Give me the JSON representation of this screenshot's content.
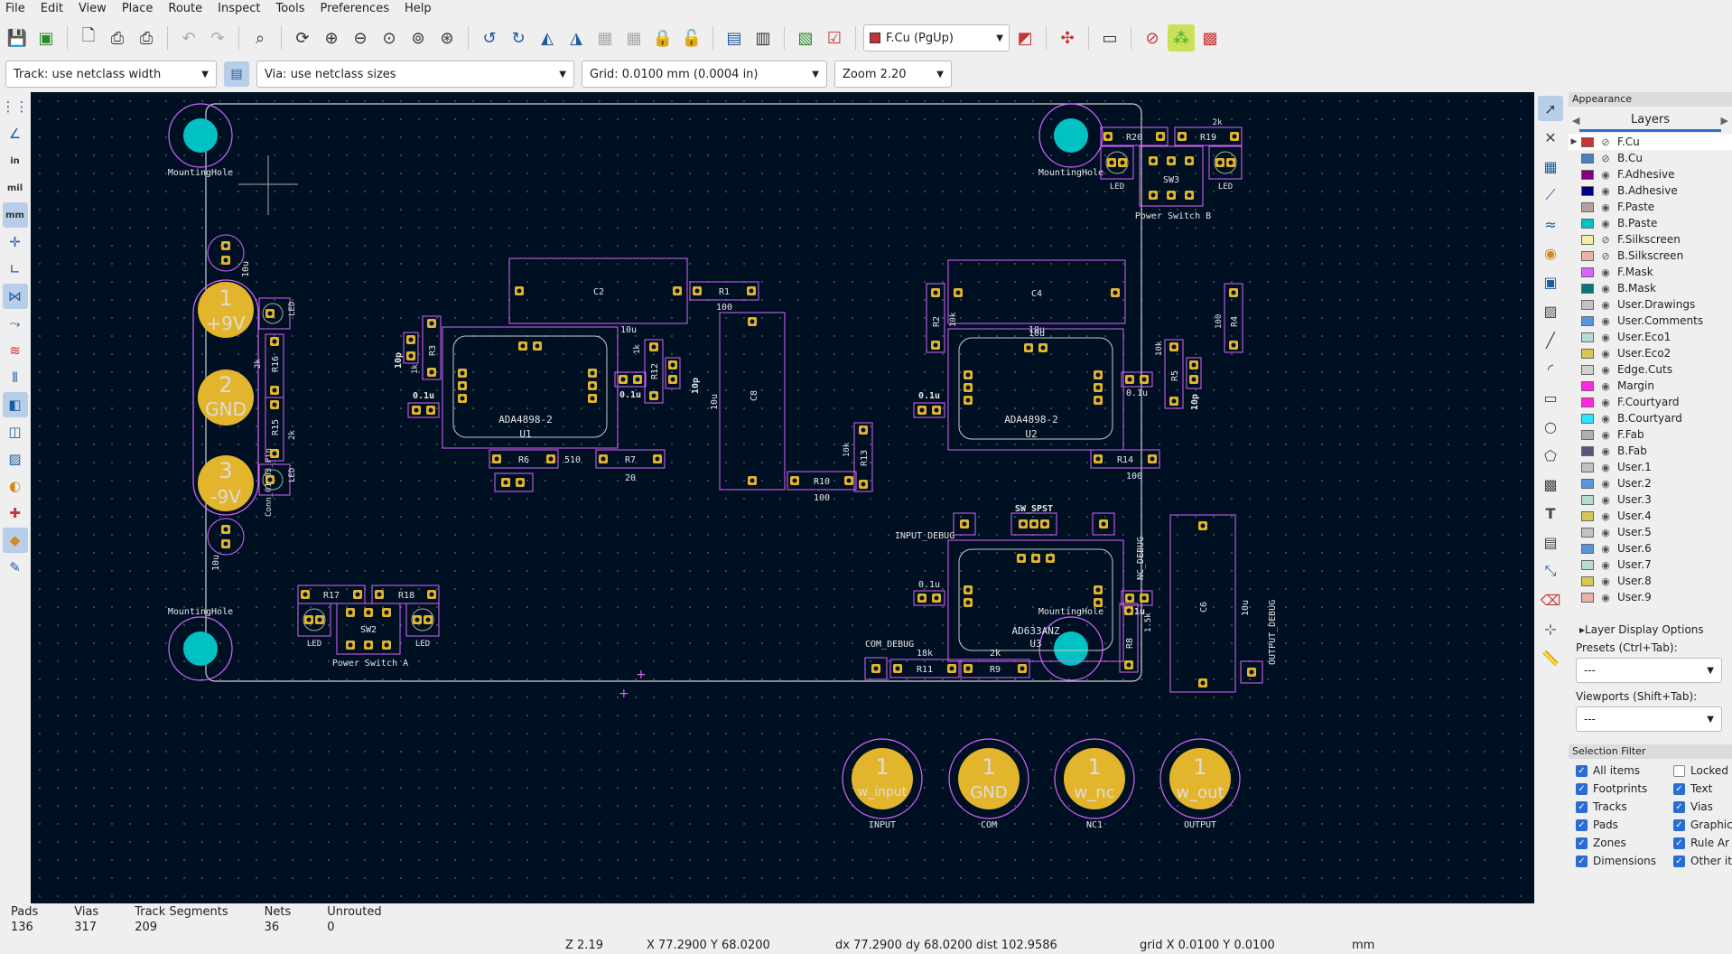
{
  "menu": [
    "File",
    "Edit",
    "View",
    "Place",
    "Route",
    "Inspect",
    "Tools",
    "Preferences",
    "Help"
  ],
  "toolbar": {
    "active_layer": "F.Cu (PgUp)",
    "track_width": "Track: use netclass width",
    "via_size": "Via: use netclass sizes",
    "grid": "Grid: 0.0100 mm (0.0004 in)",
    "zoom": "Zoom 2.20"
  },
  "left_toolbar": {
    "unit_in": "in",
    "unit_mil": "mil",
    "unit_mm": "mm"
  },
  "appearance": {
    "title": "Appearance",
    "tab": "Layers",
    "layers": [
      {
        "name": "F.Cu",
        "color": "#c83434",
        "visible": false,
        "active": true
      },
      {
        "name": "B.Cu",
        "color": "#4d7fc4",
        "visible": false
      },
      {
        "name": "F.Adhesive",
        "color": "#84007c",
        "visible": true
      },
      {
        "name": "B.Adhesive",
        "color": "#00008b",
        "visible": true
      },
      {
        "name": "F.Paste",
        "color": "#b4a0a0",
        "visible": true
      },
      {
        "name": "B.Paste",
        "color": "#00c2c2",
        "visible": true
      },
      {
        "name": "F.Silkscreen",
        "color": "#f2eda1",
        "visible": false
      },
      {
        "name": "B.Silkscreen",
        "color": "#e8b2a7",
        "visible": false
      },
      {
        "name": "F.Mask",
        "color": "#d864ff",
        "visible": true
      },
      {
        "name": "B.Mask",
        "color": "#027a7a",
        "visible": true
      },
      {
        "name": "User.Drawings",
        "color": "#c2c2c2",
        "visible": true
      },
      {
        "name": "User.Comments",
        "color": "#5994dc",
        "visible": true
      },
      {
        "name": "User.Eco1",
        "color": "#b4dbd2",
        "visible": true
      },
      {
        "name": "User.Eco2",
        "color": "#d8c852",
        "visible": true
      },
      {
        "name": "Edge.Cuts",
        "color": "#d0d2cd",
        "visible": true
      },
      {
        "name": "Margin",
        "color": "#ff26e2",
        "visible": true
      },
      {
        "name": "F.Courtyard",
        "color": "#ff26e2",
        "visible": true
      },
      {
        "name": "B.Courtyard",
        "color": "#26e9ff",
        "visible": true
      },
      {
        "name": "F.Fab",
        "color": "#afafaf",
        "visible": true
      },
      {
        "name": "B.Fab",
        "color": "#58557b",
        "visible": true
      },
      {
        "name": "User.1",
        "color": "#c2c2c2",
        "visible": true
      },
      {
        "name": "User.2",
        "color": "#5994dc",
        "visible": true
      },
      {
        "name": "User.3",
        "color": "#b4dbd2",
        "visible": true
      },
      {
        "name": "User.4",
        "color": "#d8c852",
        "visible": true
      },
      {
        "name": "User.5",
        "color": "#c2c2c2",
        "visible": true
      },
      {
        "name": "User.6",
        "color": "#5994dc",
        "visible": true
      },
      {
        "name": "User.7",
        "color": "#b4dbd2",
        "visible": true
      },
      {
        "name": "User.8",
        "color": "#d8c852",
        "visible": true
      },
      {
        "name": "User.9",
        "color": "#e8b2a7",
        "visible": true
      }
    ],
    "layer_display_options": "Layer Display Options",
    "presets_label": "Presets (Ctrl+Tab):",
    "presets_value": "---",
    "viewports_label": "Viewports (Shift+Tab):",
    "viewports_value": "---",
    "selection_filter_title": "Selection Filter",
    "selection_filter": [
      {
        "label": "All items",
        "checked": true
      },
      {
        "label": "Locked",
        "checked": false
      },
      {
        "label": "Footprints",
        "checked": true
      },
      {
        "label": "Text",
        "checked": true
      },
      {
        "label": "Tracks",
        "checked": true
      },
      {
        "label": "Vias",
        "checked": true
      },
      {
        "label": "Pads",
        "checked": true
      },
      {
        "label": "Graphic",
        "checked": true
      },
      {
        "label": "Zones",
        "checked": true
      },
      {
        "label": "Rule Ar",
        "checked": true
      },
      {
        "label": "Dimensions",
        "checked": true
      },
      {
        "label": "Other it",
        "checked": true
      }
    ]
  },
  "stats": [
    {
      "label": "Pads",
      "value": "136"
    },
    {
      "label": "Vias",
      "value": "317"
    },
    {
      "label": "Track Segments",
      "value": "209"
    },
    {
      "label": "Nets",
      "value": "36"
    },
    {
      "label": "Unrouted",
      "value": "0"
    }
  ],
  "status": {
    "zoom": "Z 2.19",
    "cursor": "X 77.2900  Y 68.0200",
    "delta": "dx 77.2900  dy 68.0200  dist 102.9586",
    "grid": "grid X 0.0100  Y 0.0100",
    "units": "mm"
  },
  "board": {
    "mounting_hole_label": "MountingHole",
    "terminals_left": [
      {
        "num": "1",
        "net": "+9V"
      },
      {
        "num": "2",
        "net": "GND"
      },
      {
        "num": "3",
        "net": "-9V"
      }
    ],
    "terminals_bottom": [
      {
        "num": "1",
        "net": "w_input",
        "label": "INPUT"
      },
      {
        "num": "1",
        "net": "GND",
        "label": "COM"
      },
      {
        "num": "1",
        "net": "w_nc",
        "label": "NC1"
      },
      {
        "num": "1",
        "net": "w_out",
        "label": "OUTPUT"
      }
    ],
    "ics": [
      {
        "ref": "U1",
        "value": "ADA4898-2"
      },
      {
        "ref": "U2",
        "value": "ADA4898-2"
      },
      {
        "ref": "U3",
        "value": "AD633ANZ"
      }
    ],
    "switches": [
      {
        "ref": "SW2",
        "label": "Power Switch A"
      },
      {
        "ref": "SW3",
        "label": "Power Switch B"
      }
    ],
    "caps": {
      "C2": "C2",
      "C4": "C4",
      "C8": "C8",
      "C6": "C6"
    },
    "labels": {
      "input_debug": "INPUT_DEBUG",
      "sw_spst": "SW_SPST",
      "nc_debug": "NC_DEBUG",
      "com_debug": "COM_DEBUG",
      "output_debug": "OUTPUT_DEBUG",
      "led": "LED",
      "conn_label": "Conn_01x03_Pin"
    },
    "resistors": {
      "R1": "R1",
      "R2": "R2",
      "R3": "R3",
      "R4": "R4",
      "R5": "R5",
      "R6": "R6",
      "R7": "R7",
      "R8": "R8",
      "R9": "R9",
      "R10": "R10",
      "R11": "R11",
      "R12": "R12",
      "R13": "R13",
      "R14": "R14",
      "R15": "R15",
      "R16": "R16",
      "R17": "R17",
      "R18": "R18",
      "R19": "R19",
      "R20": "R20"
    },
    "values": {
      "v100": "100",
      "v10u": "10u",
      "v10p": "10p",
      "v0_1u": "0.1u",
      "v1k": "1k",
      "v10k": "10k",
      "v2k": "2k",
      "v510": "510",
      "v20": "20",
      "v18k": "18k",
      "v1_5k": "1.5k",
      "v1u": "1u"
    }
  }
}
